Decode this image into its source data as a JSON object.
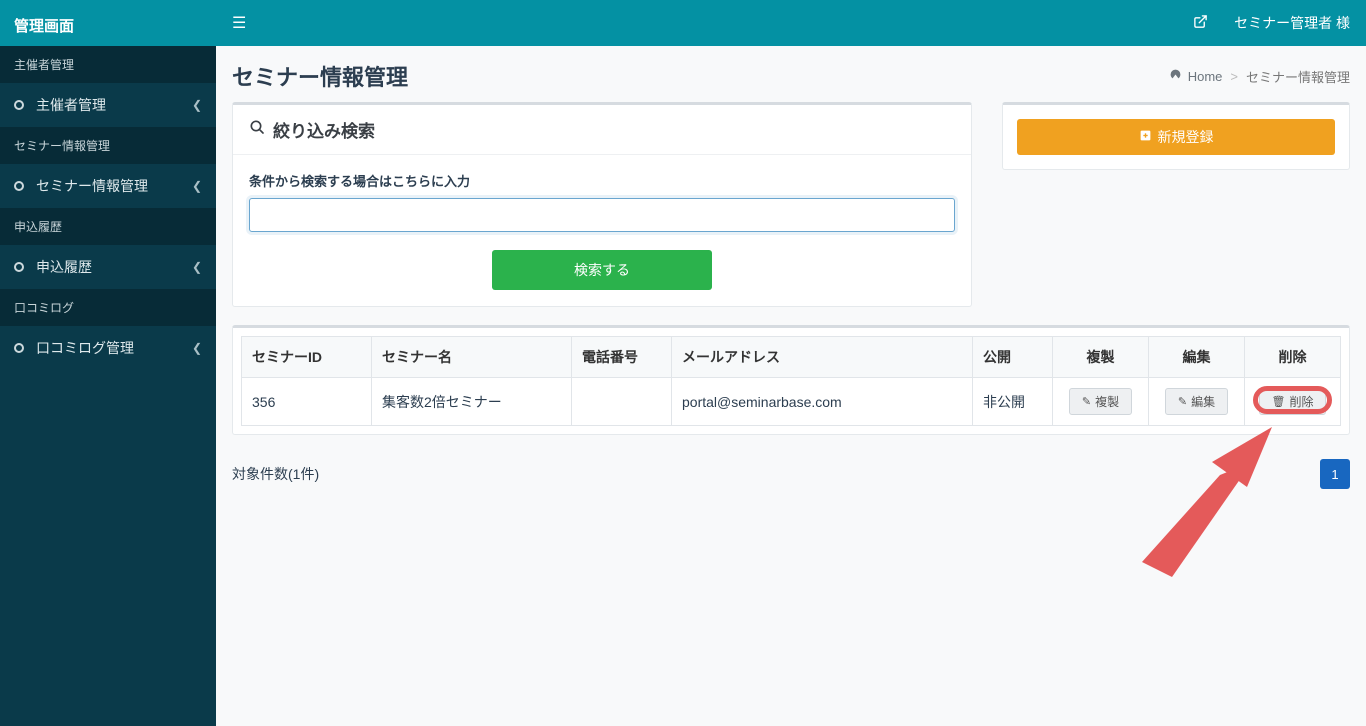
{
  "brand": "管理画面",
  "topbar": {
    "user_label": "セミナー管理者 様"
  },
  "sidebar": {
    "groups": [
      {
        "header": "主催者管理",
        "item": "主催者管理"
      },
      {
        "header": "セミナー情報管理",
        "item": "セミナー情報管理"
      },
      {
        "header": "申込履歴",
        "item": "申込履歴"
      },
      {
        "header": "口コミログ",
        "item": "口コミログ管理"
      }
    ]
  },
  "page": {
    "title": "セミナー情報管理",
    "breadcrumb_home": "Home",
    "breadcrumb_current": "セミナー情報管理"
  },
  "search_panel": {
    "heading": "絞り込み検索",
    "label": "条件から検索する場合はこちらに入力",
    "button": "検索する",
    "value": ""
  },
  "new_button": "新規登録",
  "table": {
    "headers": {
      "id": "セミナーID",
      "name": "セミナー名",
      "phone": "電話番号",
      "email": "メールアドレス",
      "pub": "公開",
      "copy": "複製",
      "edit": "編集",
      "del": "削除"
    },
    "row": {
      "id": "356",
      "name": "集客数2倍セミナー",
      "phone": "",
      "email": "portal@seminarbase.com",
      "pub": "非公開"
    },
    "btn_copy": "複製",
    "btn_edit": "編集",
    "btn_del": "削除"
  },
  "results_count": "対象件数(1件)",
  "pagination": {
    "current": "1"
  }
}
